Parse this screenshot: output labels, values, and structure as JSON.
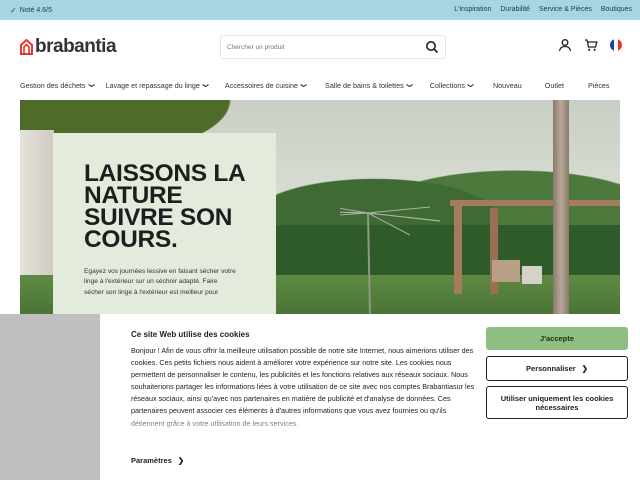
{
  "topbar": {
    "rating": "Noté 4.6/5",
    "links": [
      "L'inspiration",
      "Durabilité",
      "Service & Pièces",
      "Boutiques"
    ]
  },
  "header": {
    "logo_text": "brabantia",
    "search_placeholder": "Chercher un produit",
    "icons": [
      "user-icon",
      "cart-icon",
      "flag-fr-icon"
    ],
    "brand_color": "#e4392b"
  },
  "nav": {
    "items": [
      {
        "label": "Gestion des déchets",
        "has_dropdown": true
      },
      {
        "label": "Lavage et repassage du linge",
        "has_dropdown": true
      },
      {
        "label": "Accessoires de cuisine",
        "has_dropdown": true
      },
      {
        "label": "Salle de bains & toilettes",
        "has_dropdown": true
      },
      {
        "label": "Collections",
        "has_dropdown": true
      },
      {
        "label": "Nouveau",
        "has_dropdown": false
      },
      {
        "label": "Outlet",
        "has_dropdown": false
      },
      {
        "label": "Pièces",
        "has_dropdown": false
      }
    ]
  },
  "hero": {
    "headline": "LAISSONS LA NATURE SUIVRE SON COURS.",
    "body": "Egayez vos journées lessive en faisant sécher votre linge à l'extérieur sur un séchoir adapté. Faire sécher son linge à l'extérieur est meilleur pour"
  },
  "cookie": {
    "title": "Ce site Web utilise des cookies",
    "body": "Bonjour ! Afin de vous offrir la meilleure utilisation possible de notre site Internet, nous aimerions utiliser des cookies. Ces petits fichiers nous aident à améliorer votre expérience sur notre site. Les cookies nous permettent de personnaliser le contenu, les publicités et les fonctions relatives aux réseaux sociaux. Nous souhaiterions partager les informations liées à votre utilisation de ce site avec nos comptes Brabantiasur les réseaux sociaux, ainsi qu'avec nos partenaires en matière de publicité et d'analyse de données. Ces partenaires peuvent associer ces éléments à d'autres informations que vous avez fournies ou qu'ils détiennent grâce à votre utilisation de leurs services.",
    "params_label": "Paramètres",
    "accept_label": "J'accepte",
    "customize_label": "Personnaliser",
    "essential_label": "Utiliser uniquement les cookies nécessaires",
    "accept_color": "#8fbf80"
  }
}
